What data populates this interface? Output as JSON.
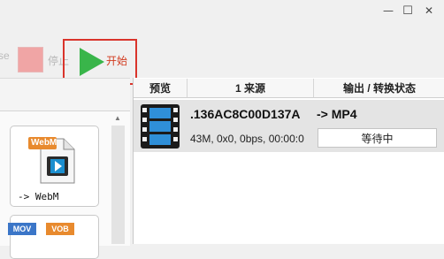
{
  "window": {
    "minimize_glyph": "—",
    "maximize_glyph": "☐",
    "close_glyph": "✕"
  },
  "toolbar": {
    "cut_label": "se",
    "stop_label": "停止",
    "start_label": "开始"
  },
  "formats": [
    {
      "badge": "WebM",
      "caption": "-> WebM"
    },
    {
      "badge_left": "MOV",
      "badge_right": "VOB"
    }
  ],
  "task_table": {
    "columns": [
      "预览",
      "1 来源",
      "输出 / 转换状态"
    ],
    "rows": [
      {
        "name": ".136AC8C00D137A",
        "info": "43M, 0x0, 0bps, 00:00:0",
        "target": "-> MP4",
        "status": "等待中"
      }
    ]
  },
  "colors": {
    "start_accent": "#39b54a",
    "highlight_border": "#d9342b",
    "stop_square": "#f0a5a5"
  }
}
